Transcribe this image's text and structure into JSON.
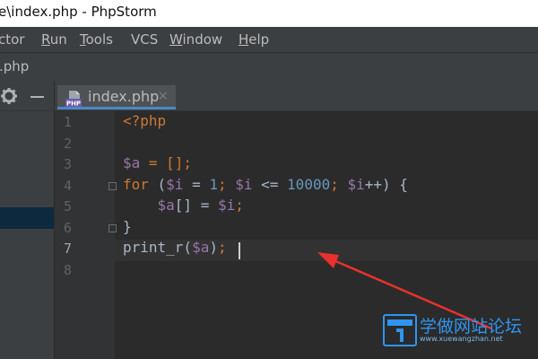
{
  "window": {
    "title": "e\\index.php - PhpStorm"
  },
  "menu": {
    "items": [
      {
        "label": "ctor",
        "underline": ""
      },
      {
        "label": "Run",
        "underline": "R"
      },
      {
        "label": "Tools",
        "underline": "T"
      },
      {
        "label": "VCS",
        "underline": ""
      },
      {
        "label": "Window",
        "underline": "W"
      },
      {
        "label": "Help",
        "underline": "H"
      }
    ]
  },
  "navbar": {
    "breadcrumb": ".php"
  },
  "tab": {
    "label": "index.php",
    "icon": "php-file-icon",
    "icon_text": "PHP",
    "close": "×"
  },
  "editor": {
    "line_numbers": [
      "1",
      "2",
      "3",
      "4",
      "5",
      "6",
      "7",
      "8"
    ],
    "current_line": 7,
    "lines": [
      [
        {
          "t": "<?php",
          "c": "kw"
        }
      ],
      [],
      [
        {
          "t": "$a",
          "c": "var"
        },
        {
          "t": " = [];",
          "c": "kw"
        }
      ],
      [
        {
          "t": "for",
          "c": "kw"
        },
        {
          "t": " (",
          "c": "plain"
        },
        {
          "t": "$i",
          "c": "var"
        },
        {
          "t": " = ",
          "c": "plain"
        },
        {
          "t": "1",
          "c": "num"
        },
        {
          "t": "; ",
          "c": "kw"
        },
        {
          "t": "$i",
          "c": "var"
        },
        {
          "t": " <= ",
          "c": "plain"
        },
        {
          "t": "10000",
          "c": "num"
        },
        {
          "t": "; ",
          "c": "kw"
        },
        {
          "t": "$i",
          "c": "var"
        },
        {
          "t": "++) {",
          "c": "plain"
        }
      ],
      [
        {
          "t": "    ",
          "c": "plain"
        },
        {
          "t": "$a",
          "c": "var"
        },
        {
          "t": "[] = ",
          "c": "plain"
        },
        {
          "t": "$i",
          "c": "var"
        },
        {
          "t": ";",
          "c": "kw"
        }
      ],
      [
        {
          "t": "}",
          "c": "plain"
        }
      ],
      [
        {
          "t": "print_r(",
          "c": "plain"
        },
        {
          "t": "$a",
          "c": "var"
        },
        {
          "t": ")",
          "c": "plain"
        },
        {
          "t": ";",
          "c": "kw"
        }
      ],
      []
    ]
  },
  "colors": {
    "arrow": "#e8312c",
    "accent": "#4a88c7",
    "watermark": "#2f95f0"
  },
  "watermark": {
    "text": "学做网站论坛",
    "url": "www.xuewangzhan.net"
  }
}
